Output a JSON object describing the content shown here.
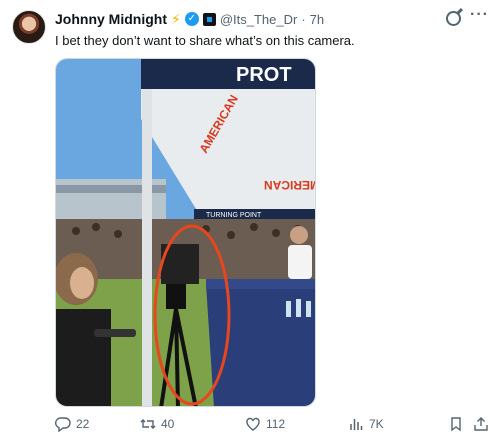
{
  "author": {
    "name": "Johnny Midnight",
    "handle": "@Its_The_Dr",
    "separator": "·",
    "time": "7h"
  },
  "tweet": {
    "text": "I bet they don’t want to share what’s on this camera."
  },
  "media": {
    "banner_text": "PROT",
    "sign_text_1": "AMERICAN",
    "sign_text_2": "MERICAN",
    "sign_text_3": "TURNING POINT"
  },
  "metrics": {
    "replies": "22",
    "reposts": "40",
    "likes": "112",
    "views": "7K"
  },
  "colors": {
    "accent": "#1d9bf0",
    "highlight_circle": "#e8461c",
    "icon_gray": "#536471"
  },
  "icons": [
    "grok-icon",
    "more-icon",
    "reply-icon",
    "retweet-icon",
    "like-icon",
    "views-icon",
    "bookmark-icon",
    "share-icon"
  ]
}
